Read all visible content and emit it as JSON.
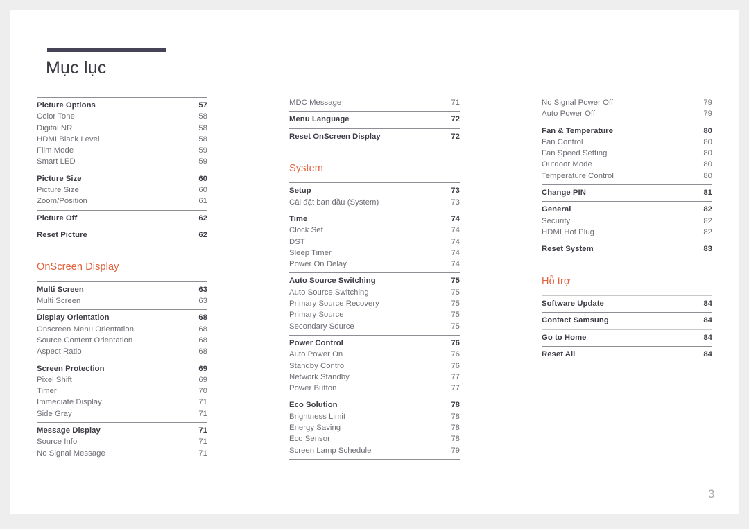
{
  "document": {
    "title": "Mục lục",
    "folio": "3",
    "accent_color": "#e1613c",
    "rule_color": "#474356",
    "body_color": "#6d6d74",
    "heading_color": "#3c3c44",
    "page_background": "#ffffff",
    "canvas_background": "#efeeee"
  },
  "columns": [
    {
      "id": "column-1",
      "blocks": [
        {
          "kind": "group",
          "rule": "dark",
          "entries": [
            {
              "label": "Picture Options",
              "page": "57",
              "bold": true
            },
            {
              "label": "Color Tone",
              "page": "58",
              "bold": false
            },
            {
              "label": "Digital NR",
              "page": "58",
              "bold": false
            },
            {
              "label": "HDMI Black Level",
              "page": "58",
              "bold": false
            },
            {
              "label": "Film Mode",
              "page": "59",
              "bold": false
            },
            {
              "label": "Smart LED",
              "page": "59",
              "bold": false
            }
          ]
        },
        {
          "kind": "group",
          "rule": "dark",
          "entries": [
            {
              "label": "Picture Size",
              "page": "60",
              "bold": true
            },
            {
              "label": "Picture Size",
              "page": "60",
              "bold": false
            },
            {
              "label": "Zoom/Position",
              "page": "61",
              "bold": false
            }
          ]
        },
        {
          "kind": "group",
          "rule": "dark",
          "entries": [
            {
              "label": "Picture Off",
              "page": "62",
              "bold": true
            }
          ]
        },
        {
          "kind": "group",
          "rule": "dark",
          "entries": [
            {
              "label": "Reset Picture",
              "page": "62",
              "bold": true
            }
          ]
        },
        {
          "kind": "heading",
          "label": "OnScreen Display"
        },
        {
          "kind": "group",
          "rule": "dark",
          "entries": [
            {
              "label": "Multi Screen",
              "page": "63",
              "bold": true
            },
            {
              "label": "Multi Screen",
              "page": "63",
              "bold": false
            }
          ]
        },
        {
          "kind": "group",
          "rule": "dark",
          "entries": [
            {
              "label": "Display Orientation",
              "page": "68",
              "bold": true
            },
            {
              "label": "Onscreen Menu Orientation",
              "page": "68",
              "bold": false
            },
            {
              "label": "Source Content Orientation",
              "page": "68",
              "bold": false
            },
            {
              "label": "Aspect Ratio",
              "page": "68",
              "bold": false
            }
          ]
        },
        {
          "kind": "group",
          "rule": "dark",
          "entries": [
            {
              "label": "Screen Protection",
              "page": "69",
              "bold": true
            },
            {
              "label": "Pixel Shift",
              "page": "69",
              "bold": false
            },
            {
              "label": "Timer",
              "page": "70",
              "bold": false
            },
            {
              "label": "Immediate Display",
              "page": "71",
              "bold": false
            },
            {
              "label": "Side Gray",
              "page": "71",
              "bold": false
            }
          ]
        },
        {
          "kind": "group",
          "rule": "dark",
          "entries": [
            {
              "label": "Message Display",
              "page": "71",
              "bold": true
            },
            {
              "label": "Source Info",
              "page": "71",
              "bold": false
            },
            {
              "label": "No Signal Message",
              "page": "71",
              "bold": false
            }
          ]
        }
      ]
    },
    {
      "id": "column-2",
      "blocks": [
        {
          "kind": "group",
          "rule": "none",
          "entries": [
            {
              "label": "MDC Message",
              "page": "71",
              "bold": false
            }
          ]
        },
        {
          "kind": "group",
          "rule": "dark",
          "entries": [
            {
              "label": "Menu Language",
              "page": "72",
              "bold": true
            }
          ]
        },
        {
          "kind": "group",
          "rule": "dark",
          "entries": [
            {
              "label": "Reset OnScreen Display",
              "page": "72",
              "bold": true
            }
          ]
        },
        {
          "kind": "heading",
          "label": "System"
        },
        {
          "kind": "group",
          "rule": "dark",
          "entries": [
            {
              "label": "Setup",
              "page": "73",
              "bold": true
            },
            {
              "label": "Cài đặt ban đầu (System)",
              "page": "73",
              "bold": false
            }
          ]
        },
        {
          "kind": "group",
          "rule": "dark",
          "entries": [
            {
              "label": "Time",
              "page": "74",
              "bold": true
            },
            {
              "label": "Clock Set",
              "page": "74",
              "bold": false
            },
            {
              "label": "DST",
              "page": "74",
              "bold": false
            },
            {
              "label": "Sleep Timer",
              "page": "74",
              "bold": false
            },
            {
              "label": "Power On Delay",
              "page": "74",
              "bold": false
            }
          ]
        },
        {
          "kind": "group",
          "rule": "dark",
          "entries": [
            {
              "label": "Auto Source Switching",
              "page": "75",
              "bold": true
            },
            {
              "label": "Auto Source Switching",
              "page": "75",
              "bold": false
            },
            {
              "label": "Primary Source Recovery",
              "page": "75",
              "bold": false
            },
            {
              "label": "Primary Source",
              "page": "75",
              "bold": false
            },
            {
              "label": "Secondary Source",
              "page": "75",
              "bold": false
            }
          ]
        },
        {
          "kind": "group",
          "rule": "dark",
          "entries": [
            {
              "label": "Power Control",
              "page": "76",
              "bold": true
            },
            {
              "label": "Auto Power On",
              "page": "76",
              "bold": false
            },
            {
              "label": "Standby Control",
              "page": "76",
              "bold": false
            },
            {
              "label": "Network Standby",
              "page": "77",
              "bold": false
            },
            {
              "label": "Power Button",
              "page": "77",
              "bold": false
            }
          ]
        },
        {
          "kind": "group",
          "rule": "dark",
          "entries": [
            {
              "label": "Eco Solution",
              "page": "78",
              "bold": true
            },
            {
              "label": "Brightness Limit",
              "page": "78",
              "bold": false
            },
            {
              "label": "Energy Saving",
              "page": "78",
              "bold": false
            },
            {
              "label": "Eco Sensor",
              "page": "78",
              "bold": false
            },
            {
              "label": "Screen Lamp Schedule",
              "page": "79",
              "bold": false
            }
          ]
        }
      ]
    },
    {
      "id": "column-3",
      "blocks": [
        {
          "kind": "group",
          "rule": "none",
          "entries": [
            {
              "label": "No Signal Power Off",
              "page": "79",
              "bold": false
            },
            {
              "label": "Auto Power Off",
              "page": "79",
              "bold": false
            }
          ]
        },
        {
          "kind": "group",
          "rule": "dark",
          "entries": [
            {
              "label": "Fan & Temperature",
              "page": "80",
              "bold": true
            },
            {
              "label": "Fan Control",
              "page": "80",
              "bold": false
            },
            {
              "label": "Fan Speed Setting",
              "page": "80",
              "bold": false
            },
            {
              "label": "Outdoor Mode",
              "page": "80",
              "bold": false
            },
            {
              "label": "Temperature Control",
              "page": "80",
              "bold": false
            }
          ]
        },
        {
          "kind": "group",
          "rule": "dark",
          "entries": [
            {
              "label": "Change PIN",
              "page": "81",
              "bold": true
            }
          ]
        },
        {
          "kind": "group",
          "rule": "dark",
          "entries": [
            {
              "label": "General",
              "page": "82",
              "bold": true
            },
            {
              "label": "Security",
              "page": "82",
              "bold": false
            },
            {
              "label": "HDMI Hot Plug",
              "page": "82",
              "bold": false
            }
          ]
        },
        {
          "kind": "group",
          "rule": "dark",
          "entries": [
            {
              "label": "Reset System",
              "page": "83",
              "bold": true
            }
          ]
        },
        {
          "kind": "heading",
          "label": "Hỗ trợ"
        },
        {
          "kind": "group",
          "rule": "light",
          "entries": [
            {
              "label": "Software Update",
              "page": "84",
              "bold": true
            }
          ]
        },
        {
          "kind": "group",
          "rule": "dark",
          "entries": [
            {
              "label": "Contact Samsung",
              "page": "84",
              "bold": true
            }
          ]
        },
        {
          "kind": "group",
          "rule": "light",
          "entries": [
            {
              "label": "Go to Home",
              "page": "84",
              "bold": true
            }
          ]
        },
        {
          "kind": "group",
          "rule": "dark",
          "entries": [
            {
              "label": "Reset All",
              "page": "84",
              "bold": true
            }
          ]
        }
      ]
    }
  ]
}
